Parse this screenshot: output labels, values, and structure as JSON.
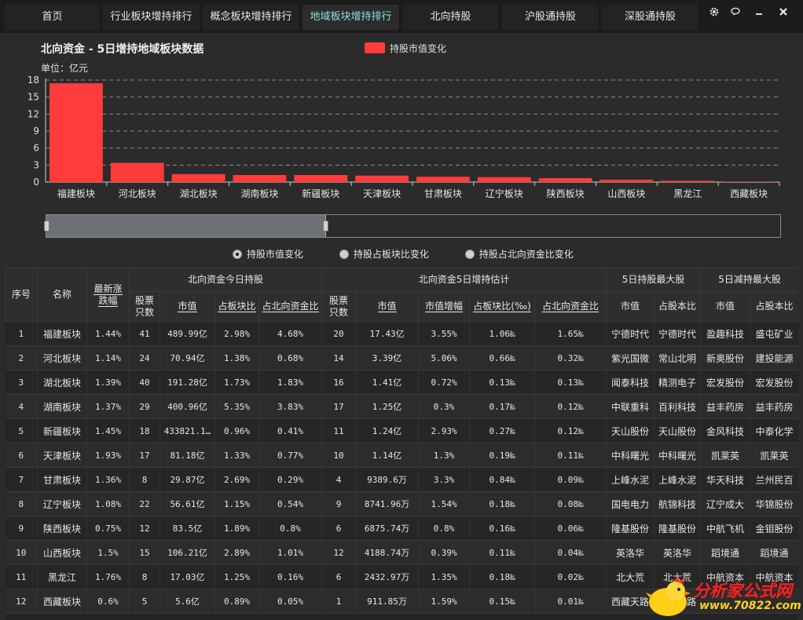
{
  "tabs": [
    {
      "label": "首页",
      "active": false
    },
    {
      "label": "行业板块增持排行",
      "active": false
    },
    {
      "label": "概念板块增持排行",
      "active": false
    },
    {
      "label": "地域板块增持排行",
      "active": true
    },
    {
      "label": "北向持股",
      "active": false
    },
    {
      "label": "沪股通持股",
      "active": false
    },
    {
      "label": "深股通持股",
      "active": false
    }
  ],
  "window_icons": [
    "gear-icon",
    "chat-icon",
    "minimize-icon",
    "close-icon"
  ],
  "chart": {
    "title": "北向资金 - 5日增持地域板块数据",
    "unit": "单位：亿元",
    "legend": "持股市值变化"
  },
  "chart_data": {
    "type": "bar",
    "title": "北向资金 - 5日增持地域板块数据",
    "ylabel": "单位：亿元",
    "categories": [
      "福建板块",
      "河北板块",
      "湖北板块",
      "湖南板块",
      "新疆板块",
      "天津板块",
      "甘肃板块",
      "辽宁板块",
      "陕西板块",
      "山西板块",
      "黑龙江",
      "西藏板块"
    ],
    "series": [
      {
        "name": "持股市值变化",
        "values": [
          17.43,
          3.39,
          1.41,
          1.25,
          1.24,
          1.14,
          0.94,
          0.87,
          0.69,
          0.42,
          0.24,
          0.09
        ]
      }
    ],
    "yticks": [
      "0",
      "3",
      "6",
      "9",
      "12",
      "15",
      "18"
    ],
    "ylim": [
      0,
      18
    ],
    "grid": true,
    "legend_position": "top",
    "color": "#ff3b3b"
  },
  "radios": [
    {
      "label": "持股市值变化",
      "checked": true
    },
    {
      "label": "持股占板块比变化",
      "checked": false
    },
    {
      "label": "持股占北向资金比变化",
      "checked": false
    }
  ],
  "table": {
    "groups": {
      "today": "北向资金今日持股",
      "five_day": "北向资金5日增持估计",
      "max_hold": "5日持股最大股",
      "max_reduce": "5日减持最大股"
    },
    "headers": {
      "seq": "序号",
      "name": "名称",
      "change": "最新涨跌幅",
      "t_count": "股票只数",
      "t_value": "市值",
      "t_sector_ratio": "占板块比",
      "t_north_ratio": "占北向资金比",
      "f_count": "股票只数",
      "f_value": "市值",
      "f_value_growth": "市值增幅",
      "f_sector_ratio": "占板块比(‰)",
      "f_north_ratio": "占北向资金比",
      "h_value": "市值",
      "h_ratio": "占股本比",
      "r_value": "市值",
      "r_ratio": "占股本比"
    },
    "rows": [
      [
        "1",
        "福建板块",
        "1.44%",
        "41",
        "489.99亿",
        "2.98%",
        "4.68%",
        "20",
        "17.43亿",
        "3.55%",
        "1.06‰",
        "1.65‰",
        "宁德时代",
        "宁德时代",
        "盈趣科技",
        "盛屯矿业"
      ],
      [
        "2",
        "河北板块",
        "1.14%",
        "24",
        "70.94亿",
        "1.38%",
        "0.68%",
        "14",
        "3.39亿",
        "5.06%",
        "0.66‰",
        "0.32‰",
        "紫光国微",
        "常山北明",
        "新奥股份",
        "建投能源"
      ],
      [
        "3",
        "湖北板块",
        "1.39%",
        "40",
        "191.28亿",
        "1.73%",
        "1.83%",
        "16",
        "1.41亿",
        "0.72%",
        "0.13‰",
        "0.13‰",
        "闻泰科技",
        "精测电子",
        "宏发股份",
        "宏发股份"
      ],
      [
        "4",
        "湖南板块",
        "1.37%",
        "29",
        "400.96亿",
        "5.35%",
        "3.83%",
        "17",
        "1.25亿",
        "0.3%",
        "0.17‰",
        "0.12‰",
        "中联重科",
        "百利科技",
        "益丰药房",
        "益丰药房"
      ],
      [
        "5",
        "新疆板块",
        "1.45%",
        "18",
        "433821.1…",
        "0.96%",
        "0.41%",
        "11",
        "1.24亿",
        "2.93%",
        "0.27‰",
        "0.12‰",
        "天山股份",
        "天山股份",
        "金风科技",
        "中泰化学"
      ],
      [
        "6",
        "天津板块",
        "1.93%",
        "17",
        "81.18亿",
        "1.33%",
        "0.77%",
        "10",
        "1.14亿",
        "1.3%",
        "0.19‰",
        "0.11‰",
        "中科曙光",
        "中科曙光",
        "凯莱英",
        "凯莱英"
      ],
      [
        "7",
        "甘肃板块",
        "1.36%",
        "8",
        "29.87亿",
        "2.69%",
        "0.29%",
        "4",
        "9389.6万",
        "3.3%",
        "0.84‰",
        "0.09‰",
        "上峰水泥",
        "上峰水泥",
        "华天科技",
        "兰州民百"
      ],
      [
        "8",
        "辽宁板块",
        "1.08%",
        "22",
        "56.61亿",
        "1.15%",
        "0.54%",
        "9",
        "8741.96万",
        "1.54%",
        "0.18‰",
        "0.08‰",
        "国电电力",
        "航锦科技",
        "辽宁成大",
        "华锦股份"
      ],
      [
        "9",
        "陕西板块",
        "0.75%",
        "12",
        "83.5亿",
        "1.89%",
        "0.8%",
        "6",
        "6875.74万",
        "0.8%",
        "0.16‰",
        "0.06‰",
        "隆基股份",
        "隆基股份",
        "中航飞机",
        "金钼股份"
      ],
      [
        "10",
        "山西板块",
        "1.5%",
        "15",
        "106.21亿",
        "2.89%",
        "1.01%",
        "12",
        "4188.74万",
        "0.39%",
        "0.11‰",
        "0.04‰",
        "英洛华",
        "英洛华",
        "蹈境通",
        "蹈境通"
      ],
      [
        "11",
        "黑龙江",
        "1.76%",
        "8",
        "17.03亿",
        "1.25%",
        "0.16%",
        "6",
        "2432.97万",
        "1.35%",
        "0.18‰",
        "0.02‰",
        "北大荒",
        "北大荒",
        "中航资本",
        "中航资本"
      ],
      [
        "12",
        "西藏板块",
        "0.6%",
        "5",
        "5.6亿",
        "0.89%",
        "0.05%",
        "1",
        "911.85万",
        "1.59%",
        "0.15‰",
        "0.01‰",
        "西藏天路",
        "西藏天路",
        "",
        ""
      ]
    ]
  },
  "watermark": {
    "text": "分析家公式网",
    "url": "www.70822.com"
  }
}
